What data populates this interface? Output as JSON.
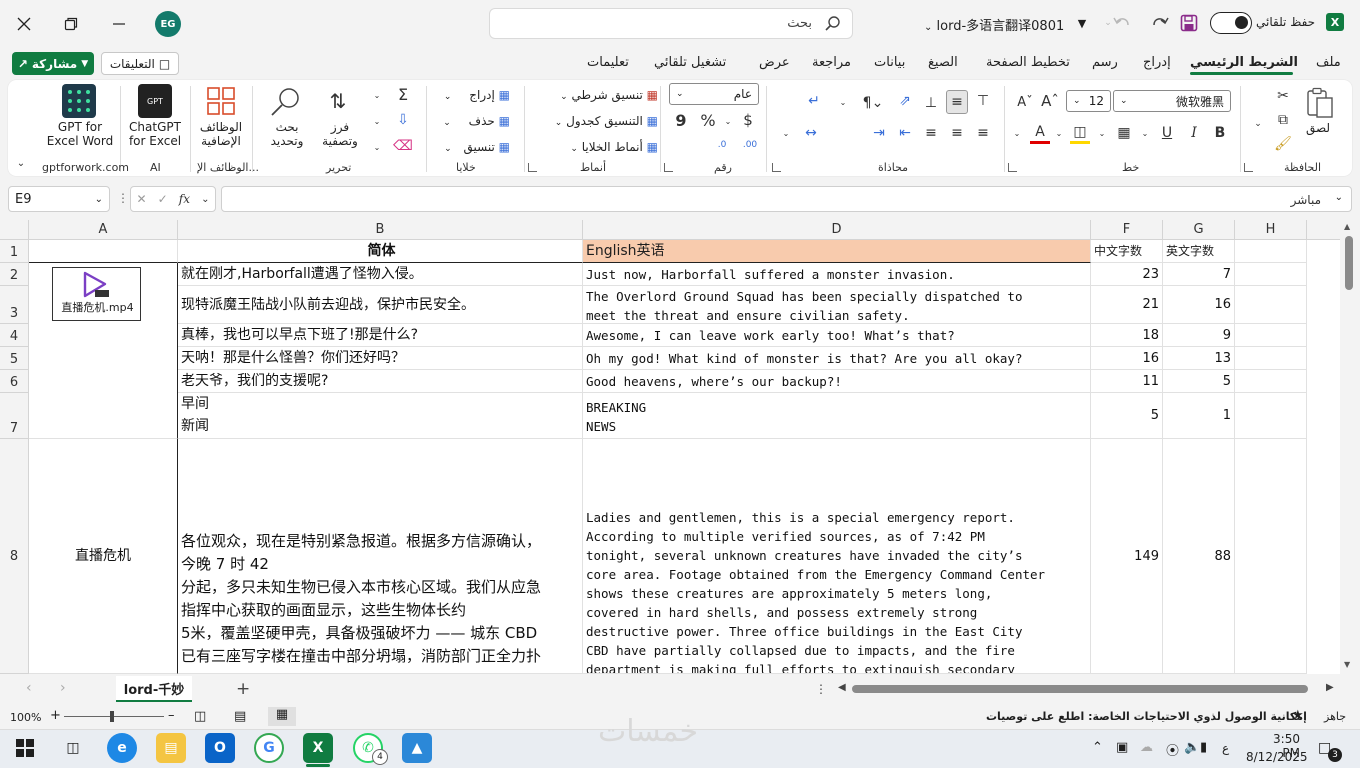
{
  "window": {
    "file_title": "lord-多语言翻译0801",
    "search_placeholder": "بحث",
    "user_initials": "EG",
    "autosave_label": "حفظ تلقائي"
  },
  "menu": {
    "share_label": "مشاركة",
    "comments_label": "التعليقات",
    "tabs": [
      "ملف",
      "الشريط الرئيسي",
      "إدراج",
      "رسم",
      "تخطيط الصفحة",
      "الصيغ",
      "بيانات",
      "مراجعة",
      "عرض",
      "تشغيل تلقائي",
      "تعليمات"
    ],
    "active_tab": "الشريط الرئيسي"
  },
  "ribbon": {
    "clipboard": {
      "label": "الحافظة",
      "paste": "لصق"
    },
    "font": {
      "label": "خط",
      "font_name": "微软雅黑",
      "font_size": "12",
      "bold": "B",
      "italic": "I",
      "underline": "U"
    },
    "alignment": {
      "label": "محاذاة"
    },
    "number": {
      "label": "رقم",
      "format": "عام",
      "currency": "$",
      "percent": "%",
      "comma": "9"
    },
    "styles": {
      "label": "أنماط",
      "conditional": "تنسيق شرطي",
      "as_table": "التنسيق كجدول",
      "cell_styles": "أنماط الخلايا"
    },
    "cells": {
      "label": "خلايا",
      "insert": "إدراج",
      "delete": "حذف",
      "format": "تنسيق"
    },
    "editing": {
      "label": "تحرير",
      "sort_filter_1": "فرز",
      "sort_filter_2": "وتصفية",
      "find_select_1": "بحث",
      "find_select_2": "وتحديد"
    },
    "addins": {
      "label": "الوظائف الإ...",
      "addins_1": "الوظائف",
      "addins_2": "الإضافية"
    },
    "ai": {
      "label": "AI",
      "chatgpt_1": "ChatGPT",
      "chatgpt_2": "for Excel"
    },
    "gptforwork": {
      "label": "gptforwork.com",
      "gpt_1": "GPT for",
      "gpt_2": "Excel Word"
    }
  },
  "formula_bar": {
    "name_box": "E9",
    "fx": "fx",
    "mode": "مباشر"
  },
  "grid": {
    "columns": [
      "A",
      "B",
      "D",
      "F",
      "G",
      "H"
    ],
    "rows": [
      "1",
      "2",
      "3",
      "4",
      "5",
      "6",
      "7",
      "8"
    ],
    "header": {
      "b": "简体",
      "d": "English英语",
      "f": "中文字数",
      "g": "英文字数"
    },
    "embedded_file": "直播危机.mp4",
    "a8": "直播危机",
    "data_rows": [
      {
        "zh": "就在刚才,Harborfall遭遇了怪物入侵。",
        "en": "Just now, Harborfall suffered a monster invasion.",
        "zh_count": "23",
        "en_count": "7"
      },
      {
        "zh": "现特派魔王陆战小队前去迎战，保护市民安全。",
        "en": "The Overlord Ground Squad has been specially dispatched to\nmeet the threat and ensure civilian safety.",
        "zh_count": "21",
        "en_count": "16"
      },
      {
        "zh": "真棒，我也可以早点下班了!那是什么?",
        "en": "Awesome, I can leave work early too! What’s that?",
        "zh_count": "18",
        "en_count": "9"
      },
      {
        "zh": "天呐！那是什么怪兽？你们还好吗？",
        "en": "Oh my god! What kind of monster is that? Are you all okay?",
        "zh_count": "16",
        "en_count": "13"
      },
      {
        "zh": "老天爷，我们的支援呢?",
        "en": "Good heavens, where’s our backup?!",
        "zh_count": "11",
        "en_count": "5"
      },
      {
        "zh": "早间\n新闻",
        "en": "BREAKING\nNEWS",
        "zh_count": "5",
        "en_count": "1"
      },
      {
        "zh": "各位观众，现在是特别紧急报道。根据多方信源确认，\n今晚 7 时 42\n分起，多只未知生物已侵入本市核心区域。我们从应急\n指挥中心获取的画面显示，这些生物体长约\n5米，覆盖坚硬甲壳，具备极强破坏力 —— 城东 CBD\n已有三座写字楼在撞击中部分坍塌，消防部门正全力扑",
        "en": "Ladies and gentlemen, this is a special emergency report.\nAccording to multiple verified sources, as of 7:42 PM\ntonight, several unknown creatures have invaded the city’s\ncore area. Footage obtained from the Emergency Command Center\nshows these creatures are approximately 5 meters long,\ncovered in hard shells, and possess extremely strong\ndestructive power. Three office buildings in the East City\nCBD have partially collapsed due to impacts, and the fire\ndepartment is making full efforts to extinguish secondary",
        "zh_count": "149",
        "en_count": "88"
      }
    ]
  },
  "sheet_tab": "lord-千妙",
  "status": {
    "ready": "جاهز",
    "accessibility": "إمكانية الوصول لذوي الاحتياجات الخاصة: اطلع على توصيات",
    "zoom": "100%"
  },
  "taskbar": {
    "time": "3:50 PM",
    "date": "8/12/2025",
    "lang": "ع",
    "notif_count": "3",
    "whatsapp_badge": "4",
    "watermark": "خمسات"
  },
  "colors": {
    "accent": "#107c41",
    "header_fill": "#f8cbad"
  }
}
